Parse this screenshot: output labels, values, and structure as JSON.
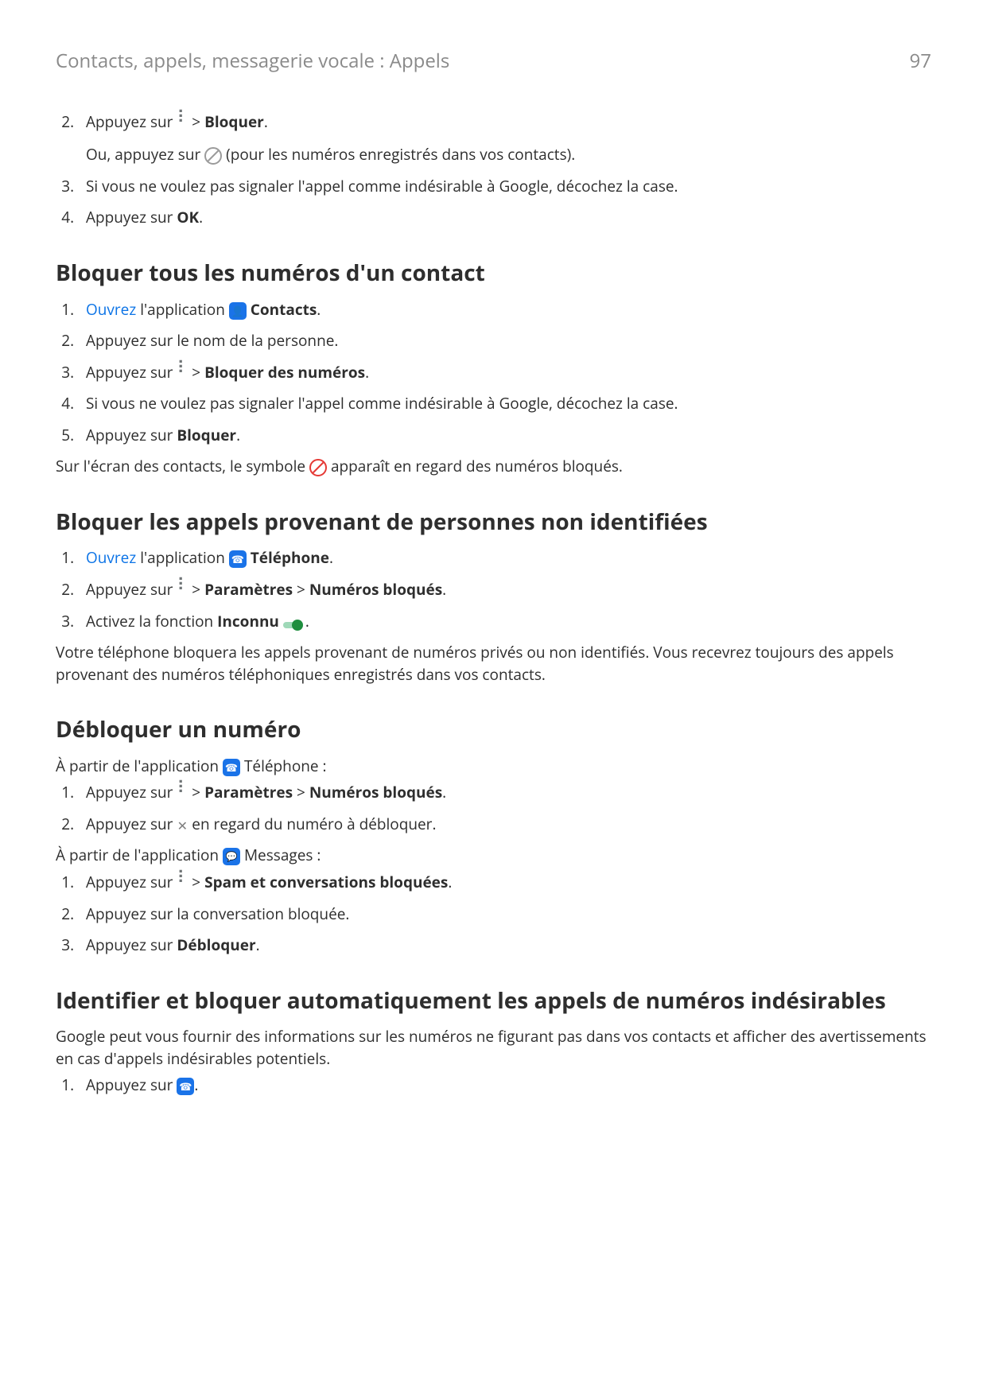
{
  "header": {
    "breadcrumb": "Contacts, appels, messagerie vocale : Appels",
    "page": "97"
  },
  "s0": {
    "li2_a": "Appuyez sur ",
    "li2_b": " > ",
    "li2_bold": "Bloquer",
    "li2_c": ".",
    "li2_sub_a": "Ou, appuyez sur ",
    "li2_sub_b": " (pour les numéros enregistrés dans vos contacts).",
    "li3": "Si vous ne voulez pas signaler l'appel comme indésirable à Google, décochez la case.",
    "li4_a": "Appuyez sur ",
    "li4_bold": "OK",
    "li4_b": "."
  },
  "s1": {
    "title": "Bloquer tous les numéros d'un contact",
    "li1_link": "Ouvrez",
    "li1_a": " l'application ",
    "li1_bold": "Contacts",
    "li1_b": ".",
    "li2": "Appuyez sur le nom de la personne.",
    "li3_a": "Appuyez sur ",
    "li3_b": " > ",
    "li3_bold": "Bloquer des numéros",
    "li3_c": ".",
    "li4": "Si vous ne voulez pas signaler l'appel comme indésirable à Google, décochez la case.",
    "li5_a": "Appuyez sur ",
    "li5_bold": "Bloquer",
    "li5_b": ".",
    "tail_a": "Sur l'écran des contacts, le symbole ",
    "tail_b": " apparaît en regard des numéros bloqués."
  },
  "s2": {
    "title": "Bloquer les appels provenant de personnes non identifiées",
    "li1_link": "Ouvrez",
    "li1_a": " l'application ",
    "li1_bold": "Téléphone",
    "li1_b": ".",
    "li2_a": "Appuyez sur ",
    "li2_b": " > ",
    "li2_bold1": "Paramètres",
    "li2_c": " > ",
    "li2_bold2": "Numéros bloqués",
    "li2_d": ".",
    "li3_a": "Activez la fonction ",
    "li3_bold": "Inconnu",
    "li3_b": " ",
    "li3_c": ".",
    "tail": "Votre téléphone bloquera les appels provenant de numéros privés ou non identifiés. Vous recevrez toujours des appels provenant des numéros téléphoniques enregistrés dans vos contacts."
  },
  "s3": {
    "title": "Débloquer un numéro",
    "intro1_a": "À partir de l'application ",
    "intro1_b": " Téléphone :",
    "li1_a": "Appuyez sur ",
    "li1_b": " > ",
    "li1_bold1": "Paramètres",
    "li1_c": " > ",
    "li1_bold2": "Numéros bloqués",
    "li1_d": ".",
    "li2_a": "Appuyez sur ",
    "li2_b": " en regard du numéro à débloquer.",
    "intro2_a": "À partir de l'application ",
    "intro2_b": " Messages :",
    "mli1_a": "Appuyez sur ",
    "mli1_b": " > ",
    "mli1_bold": "Spam et conversations bloquées",
    "mli1_c": ".",
    "mli2": "Appuyez sur la conversation bloquée.",
    "mli3_a": "Appuyez sur ",
    "mli3_bold": "Débloquer",
    "mli3_b": "."
  },
  "s4": {
    "title": "Identifier et bloquer automatiquement les appels de numéros indésirables",
    "intro": "Google peut vous fournir des informations sur les numéros ne figurant pas dans vos contacts et afficher des avertissements en cas d'appels indésirables potentiels.",
    "li1_a": "Appuyez sur ",
    "li1_b": "."
  }
}
